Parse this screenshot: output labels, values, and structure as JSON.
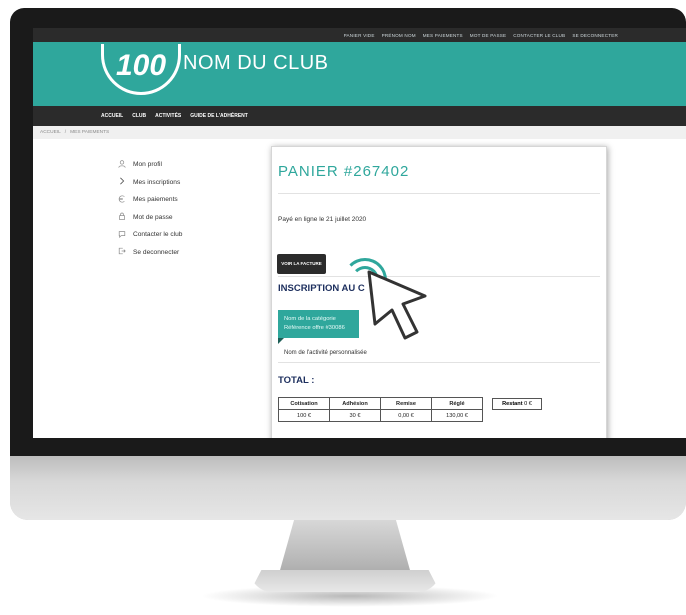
{
  "topbar": {
    "links": [
      "PANIER VIDE",
      "PRÉNOM NOM",
      "MES PAIEMENTS",
      "MOT DE PASSE",
      "CONTACTER LE CLUB",
      "SE DECONNECTER"
    ]
  },
  "header": {
    "logo_text": "100",
    "club_name": "NOM DU CLUB"
  },
  "mainnav": {
    "items": [
      "ACCUEIL",
      "CLUB",
      "ACTIVITÉS",
      "GUIDE DE L'ADHÉRENT"
    ]
  },
  "breadcrumb": {
    "home": "ACCUEIL",
    "separator": "/",
    "current": "MES PAIEMENTS"
  },
  "sidebar": {
    "items": [
      {
        "icon": "user-icon",
        "label": "Mon profil"
      },
      {
        "icon": "chevron-right-icon",
        "label": "Mes inscriptions"
      },
      {
        "icon": "euro-icon",
        "label": "Mes paiements"
      },
      {
        "icon": "lock-icon",
        "label": "Mot de passe"
      },
      {
        "icon": "chat-icon",
        "label": "Contacter le club"
      },
      {
        "icon": "logout-icon",
        "label": "Se deconnecter"
      }
    ]
  },
  "cart": {
    "title": "PANIER #267402",
    "paid_text": "Payé en ligne le 21 juillet 2020",
    "invoice_button": "VOIR LA FACTURE",
    "inscription_heading": "INSCRIPTION AU C",
    "category_name": "Nom de la catégorie",
    "offer_reference": "Référence offre #30086",
    "activity_name": "Nom de l'activité personnalisée",
    "total_heading": "TOTAL :",
    "table": {
      "headers": [
        "Cotisation",
        "Adhésion",
        "Remise",
        "Réglé"
      ],
      "values": [
        "100 €",
        "30 €",
        "0,00 €",
        "130,00 €"
      ]
    },
    "restant_label": "Restant",
    "restant_value": "0 €"
  },
  "colors": {
    "accent": "#2fa79c",
    "dark": "#2b2b2b",
    "navy": "#1d2f5e"
  }
}
